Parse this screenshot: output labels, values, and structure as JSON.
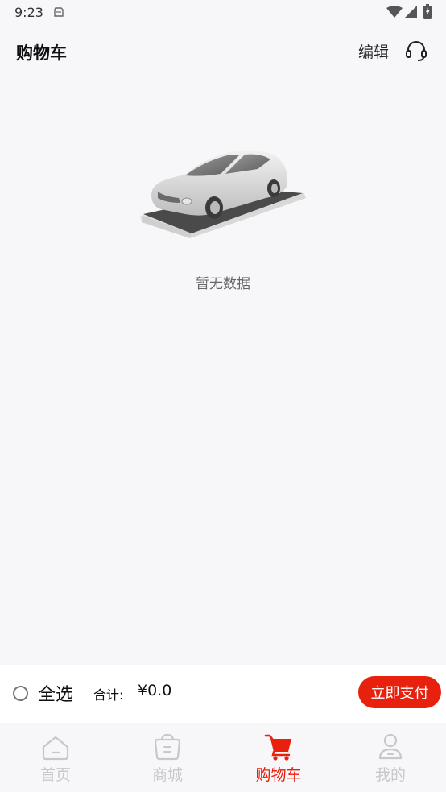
{
  "status_bar": {
    "time": "9:23"
  },
  "header": {
    "title": "购物车",
    "edit_label": "编辑",
    "support_icon": "headset-icon"
  },
  "empty_state": {
    "message": "暂无数据",
    "illustration": "car-icon"
  },
  "checkout": {
    "select_all_label": "全选",
    "total_label": "合计:",
    "total_value": "¥0.0",
    "pay_label": "立即支付"
  },
  "tabs": [
    {
      "label": "首页",
      "icon": "home-icon",
      "active": false
    },
    {
      "label": "商城",
      "icon": "shopping-bag-icon",
      "active": false
    },
    {
      "label": "购物车",
      "icon": "cart-icon",
      "active": true
    },
    {
      "label": "我的",
      "icon": "user-icon",
      "active": false
    }
  ],
  "colors": {
    "accent": "#e8210f",
    "background": "#f7f7fa",
    "inactive_tab": "#c8c8cc"
  }
}
